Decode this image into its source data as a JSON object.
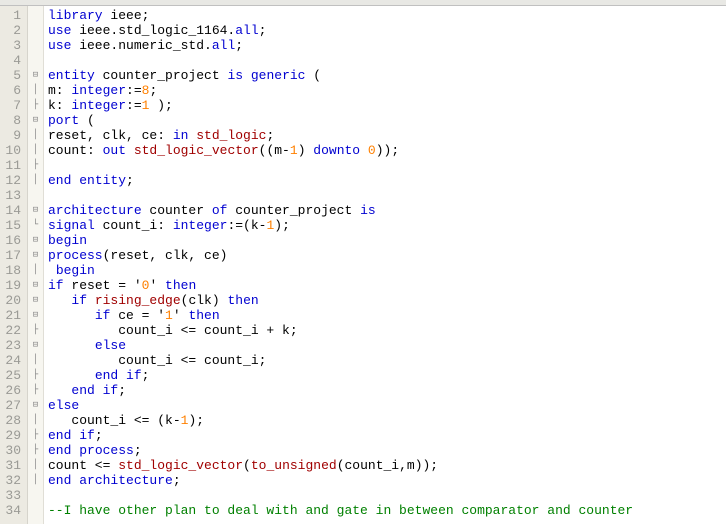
{
  "lines": [
    {
      "n": 1,
      "fold": "",
      "indent": 5,
      "tokens": [
        {
          "t": "library",
          "c": "kw"
        },
        {
          "t": " ieee;",
          "c": ""
        }
      ]
    },
    {
      "n": 2,
      "fold": "",
      "indent": 5,
      "tokens": [
        {
          "t": "use",
          "c": "kw"
        },
        {
          "t": " ieee.std_logic_1164.",
          "c": ""
        },
        {
          "t": "all",
          "c": "kw"
        },
        {
          "t": ";",
          "c": ""
        }
      ]
    },
    {
      "n": 3,
      "fold": "",
      "indent": 5,
      "tokens": [
        {
          "t": "use",
          "c": "kw"
        },
        {
          "t": " ieee.numeric_std.",
          "c": ""
        },
        {
          "t": "all",
          "c": "kw"
        },
        {
          "t": ";",
          "c": ""
        }
      ]
    },
    {
      "n": 4,
      "fold": "",
      "indent": 0,
      "tokens": []
    },
    {
      "n": 5,
      "fold": "⊟",
      "indent": 5,
      "tokens": [
        {
          "t": "entity",
          "c": "kw"
        },
        {
          "t": " counter_project ",
          "c": ""
        },
        {
          "t": "is",
          "c": "kw"
        },
        {
          "t": " ",
          "c": ""
        },
        {
          "t": "generic",
          "c": "kw"
        },
        {
          "t": " (",
          "c": ""
        }
      ]
    },
    {
      "n": 6,
      "fold": "│",
      "indent": 5,
      "tokens": [
        {
          "t": "m: ",
          "c": ""
        },
        {
          "t": "integer",
          "c": "kw"
        },
        {
          "t": ":=",
          "c": ""
        },
        {
          "t": "8",
          "c": "num"
        },
        {
          "t": ";",
          "c": ""
        }
      ]
    },
    {
      "n": 7,
      "fold": "├",
      "indent": 5,
      "tokens": [
        {
          "t": "k: ",
          "c": ""
        },
        {
          "t": "integer",
          "c": "kw"
        },
        {
          "t": ":=",
          "c": ""
        },
        {
          "t": "1",
          "c": "num"
        },
        {
          "t": " );",
          "c": ""
        }
      ]
    },
    {
      "n": 8,
      "fold": "⊟",
      "indent": 5,
      "tokens": [
        {
          "t": "port",
          "c": "kw"
        },
        {
          "t": " (",
          "c": ""
        }
      ]
    },
    {
      "n": 9,
      "fold": "│",
      "indent": 5,
      "tokens": [
        {
          "t": "reset, clk, ce: ",
          "c": ""
        },
        {
          "t": "in",
          "c": "kw"
        },
        {
          "t": " ",
          "c": ""
        },
        {
          "t": "std_logic",
          "c": "func"
        },
        {
          "t": ";",
          "c": ""
        }
      ]
    },
    {
      "n": 10,
      "fold": "│",
      "indent": 5,
      "tokens": [
        {
          "t": "count: ",
          "c": ""
        },
        {
          "t": "out",
          "c": "kw"
        },
        {
          "t": " ",
          "c": ""
        },
        {
          "t": "std_logic_vector",
          "c": "func"
        },
        {
          "t": "((m-",
          "c": ""
        },
        {
          "t": "1",
          "c": "num"
        },
        {
          "t": ") ",
          "c": ""
        },
        {
          "t": "downto",
          "c": "kw"
        },
        {
          "t": " ",
          "c": ""
        },
        {
          "t": "0",
          "c": "num"
        },
        {
          "t": "));",
          "c": ""
        }
      ]
    },
    {
      "n": 11,
      "fold": "├",
      "indent": 5,
      "tokens": []
    },
    {
      "n": 12,
      "fold": "│",
      "indent": 5,
      "tokens": [
        {
          "t": "end",
          "c": "kw"
        },
        {
          "t": " ",
          "c": ""
        },
        {
          "t": "entity",
          "c": "kw"
        },
        {
          "t": ";",
          "c": ""
        }
      ]
    },
    {
      "n": 13,
      "fold": "",
      "indent": 0,
      "tokens": []
    },
    {
      "n": 14,
      "fold": "⊟",
      "indent": 5,
      "tokens": [
        {
          "t": "architecture",
          "c": "kw"
        },
        {
          "t": " counter ",
          "c": ""
        },
        {
          "t": "of",
          "c": "kw"
        },
        {
          "t": " counter_project ",
          "c": ""
        },
        {
          "t": "is",
          "c": "kw"
        }
      ]
    },
    {
      "n": 15,
      "fold": "└",
      "indent": 5,
      "tokens": [
        {
          "t": "signal",
          "c": "kw"
        },
        {
          "t": " count_i: ",
          "c": ""
        },
        {
          "t": "integer",
          "c": "kw"
        },
        {
          "t": ":=(k-",
          "c": ""
        },
        {
          "t": "1",
          "c": "num"
        },
        {
          "t": ");",
          "c": ""
        }
      ]
    },
    {
      "n": 16,
      "fold": "⊟",
      "indent": 5,
      "tokens": [
        {
          "t": "begin",
          "c": "kw"
        }
      ]
    },
    {
      "n": 17,
      "fold": "⊟",
      "indent": 5,
      "tokens": [
        {
          "t": "process",
          "c": "kw"
        },
        {
          "t": "(reset, clk, ce)",
          "c": ""
        }
      ]
    },
    {
      "n": 18,
      "fold": "│",
      "indent": 5,
      "tokens": [
        {
          "t": " ",
          "c": ""
        },
        {
          "t": "begin",
          "c": "kw"
        }
      ]
    },
    {
      "n": 19,
      "fold": "⊟",
      "indent": 5,
      "tokens": [
        {
          "t": "if",
          "c": "kw"
        },
        {
          "t": " reset = '",
          "c": ""
        },
        {
          "t": "0",
          "c": "num"
        },
        {
          "t": "' ",
          "c": ""
        },
        {
          "t": "then",
          "c": "kw"
        }
      ]
    },
    {
      "n": 20,
      "fold": "⊟",
      "indent": 5,
      "tokens": [
        {
          "t": "   ",
          "c": ""
        },
        {
          "t": "if",
          "c": "kw"
        },
        {
          "t": " ",
          "c": ""
        },
        {
          "t": "rising_edge",
          "c": "func"
        },
        {
          "t": "(clk) ",
          "c": ""
        },
        {
          "t": "then",
          "c": "kw"
        }
      ]
    },
    {
      "n": 21,
      "fold": "⊟",
      "indent": 5,
      "tokens": [
        {
          "t": "      ",
          "c": ""
        },
        {
          "t": "if",
          "c": "kw"
        },
        {
          "t": " ce = '",
          "c": ""
        },
        {
          "t": "1",
          "c": "num"
        },
        {
          "t": "' ",
          "c": ""
        },
        {
          "t": "then",
          "c": "kw"
        }
      ]
    },
    {
      "n": 22,
      "fold": "├",
      "indent": 5,
      "tokens": [
        {
          "t": "         count_i <= count_i + k;",
          "c": ""
        }
      ]
    },
    {
      "n": 23,
      "fold": "⊟",
      "indent": 5,
      "tokens": [
        {
          "t": "      ",
          "c": ""
        },
        {
          "t": "else",
          "c": "kw"
        }
      ]
    },
    {
      "n": 24,
      "fold": "│",
      "indent": 5,
      "tokens": [
        {
          "t": "         count_i <= count_i;",
          "c": ""
        }
      ]
    },
    {
      "n": 25,
      "fold": "├",
      "indent": 5,
      "tokens": [
        {
          "t": "      ",
          "c": ""
        },
        {
          "t": "end",
          "c": "kw"
        },
        {
          "t": " ",
          "c": ""
        },
        {
          "t": "if",
          "c": "kw"
        },
        {
          "t": ";",
          "c": ""
        }
      ]
    },
    {
      "n": 26,
      "fold": "├",
      "indent": 5,
      "tokens": [
        {
          "t": "   ",
          "c": ""
        },
        {
          "t": "end",
          "c": "kw"
        },
        {
          "t": " ",
          "c": ""
        },
        {
          "t": "if",
          "c": "kw"
        },
        {
          "t": ";",
          "c": ""
        }
      ]
    },
    {
      "n": 27,
      "fold": "⊟",
      "indent": 5,
      "tokens": [
        {
          "t": "else",
          "c": "kw"
        }
      ]
    },
    {
      "n": 28,
      "fold": "│",
      "indent": 5,
      "tokens": [
        {
          "t": "   count_i <= (k-",
          "c": ""
        },
        {
          "t": "1",
          "c": "num"
        },
        {
          "t": ");",
          "c": ""
        }
      ]
    },
    {
      "n": 29,
      "fold": "├",
      "indent": 5,
      "tokens": [
        {
          "t": "end",
          "c": "kw"
        },
        {
          "t": " ",
          "c": ""
        },
        {
          "t": "if",
          "c": "kw"
        },
        {
          "t": ";",
          "c": ""
        }
      ]
    },
    {
      "n": 30,
      "fold": "├",
      "indent": 5,
      "tokens": [
        {
          "t": "end",
          "c": "kw"
        },
        {
          "t": " ",
          "c": ""
        },
        {
          "t": "process",
          "c": "kw"
        },
        {
          "t": ";",
          "c": ""
        }
      ]
    },
    {
      "n": 31,
      "fold": "│",
      "indent": 5,
      "tokens": [
        {
          "t": "count <= ",
          "c": ""
        },
        {
          "t": "std_logic_vector",
          "c": "func"
        },
        {
          "t": "(",
          "c": ""
        },
        {
          "t": "to_unsigned",
          "c": "func"
        },
        {
          "t": "(count_i,m));",
          "c": ""
        }
      ]
    },
    {
      "n": 32,
      "fold": "│",
      "indent": 5,
      "tokens": [
        {
          "t": "end",
          "c": "kw"
        },
        {
          "t": " ",
          "c": ""
        },
        {
          "t": "architecture",
          "c": "kw"
        },
        {
          "t": ";",
          "c": ""
        }
      ]
    },
    {
      "n": 33,
      "fold": "",
      "indent": 0,
      "tokens": []
    },
    {
      "n": 34,
      "fold": "",
      "indent": 5,
      "tokens": [
        {
          "t": "--I have other plan to deal with and gate in between comparator and counter",
          "c": "comment"
        }
      ]
    }
  ]
}
